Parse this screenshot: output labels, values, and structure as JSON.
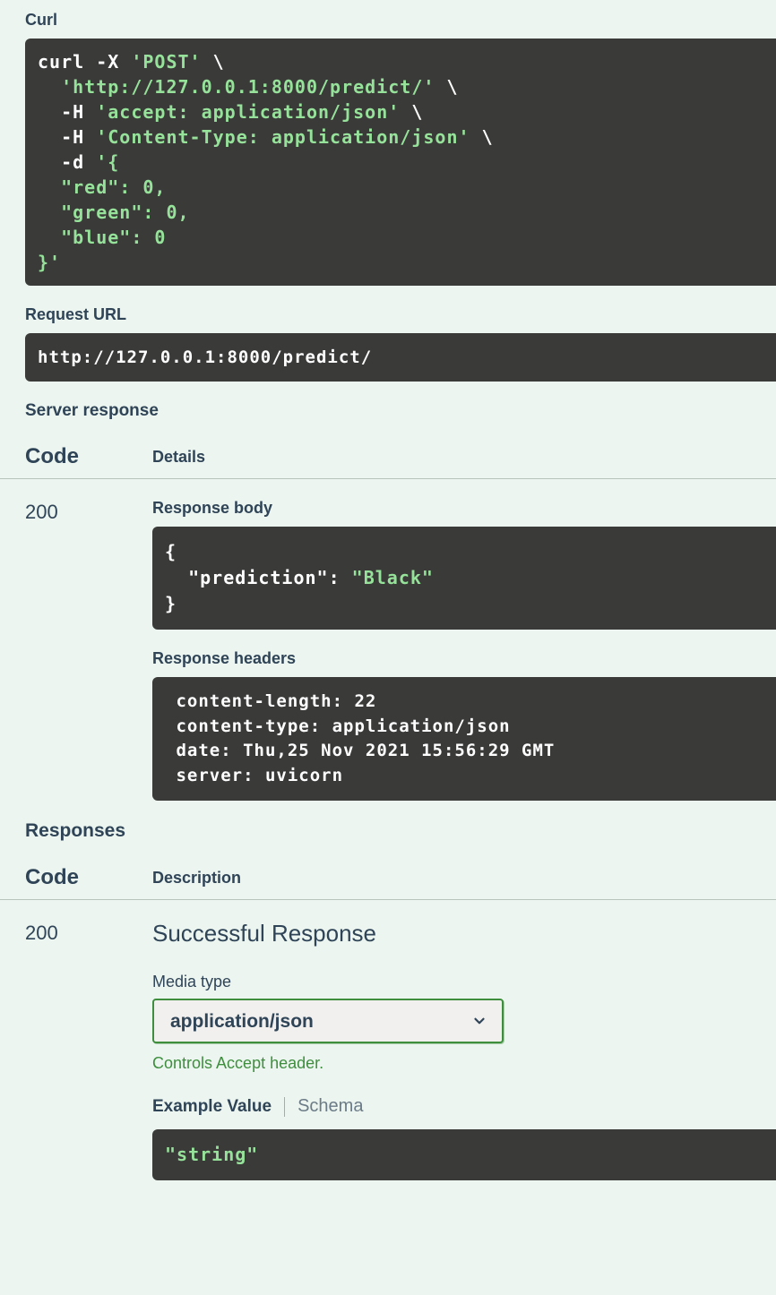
{
  "labels": {
    "curl": "Curl",
    "request_url": "Request URL",
    "server_response": "Server response",
    "code": "Code",
    "details": "Details",
    "description": "Description",
    "response_body": "Response body",
    "response_headers": "Response headers",
    "responses": "Responses",
    "successful_response": "Successful Response",
    "media_type": "Media type",
    "controls_accept_prefix": "Controls ",
    "controls_accept_mid": "Accept",
    "controls_accept_suffix": " header.",
    "example_value": "Example Value",
    "schema": "Schema"
  },
  "curl": {
    "l0a": "curl -X ",
    "l0b": "'POST'",
    "l0c": " \\",
    "l1": "  'http://127.0.0.1:8000/predict/'",
    "l1b": " \\",
    "l2a": "  -H ",
    "l2b": "'accept: application/json'",
    "l2c": " \\",
    "l3a": "  -H ",
    "l3b": "'Content-Type: application/json'",
    "l3c": " \\",
    "l4a": "  -d ",
    "l4b": "'{",
    "l5": "  \"red\": 0,",
    "l6": "  \"green\": 0,",
    "l7": "  \"blue\": 0",
    "l8": "}'"
  },
  "request_url_value": "http://127.0.0.1:8000/predict/",
  "server": {
    "code": "200",
    "body_l0": "{",
    "body_l1a": "  \"prediction\"",
    "body_l1b": ": ",
    "body_l1c": "\"Black\"",
    "body_l2": "}",
    "headers": " content-length: 22 \n content-type: application/json \n date: Thu,25 Nov 2021 15:56:29 GMT \n server: uvicorn "
  },
  "responses": {
    "code": "200",
    "media_type_value": "application/json",
    "example": "\"string\""
  }
}
